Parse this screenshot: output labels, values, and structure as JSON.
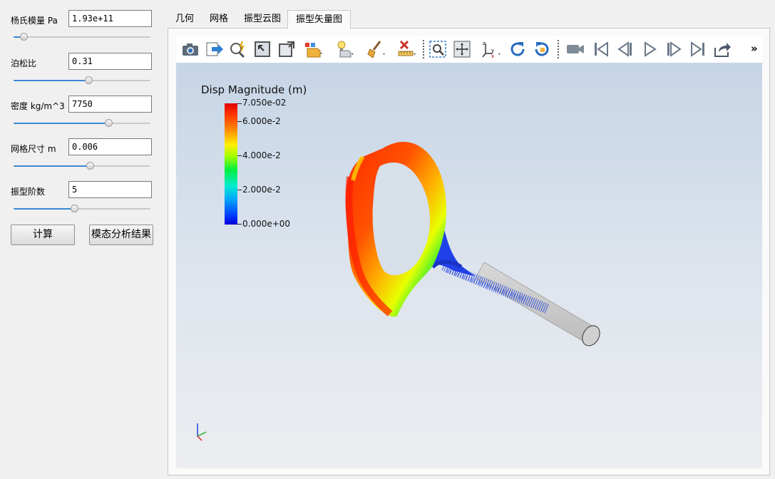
{
  "params": [
    {
      "label": "杨氏模量 Pa",
      "value": "1.93e+11",
      "slider": 0.08
    },
    {
      "label": "泊松比",
      "value": "0.31",
      "slider": 0.55
    },
    {
      "label": "密度 kg/m^3",
      "value": "7750",
      "slider": 0.7
    },
    {
      "label": "网格尺寸 m",
      "value": "0.006",
      "slider": 0.56
    },
    {
      "label": "振型阶数",
      "value": "5",
      "slider": 0.45
    }
  ],
  "buttons": {
    "compute": "计算",
    "results": "模态分析结果"
  },
  "tabs": [
    {
      "label": "几何",
      "active": false
    },
    {
      "label": "网格",
      "active": false
    },
    {
      "label": "振型云图",
      "active": false
    },
    {
      "label": "振型矢量图",
      "active": true
    }
  ],
  "toolbar": {
    "icons": [
      "camera-icon",
      "export-icon",
      "pick-icon",
      "reset-view-icon",
      "maximize-icon",
      "color-map-icon",
      "lighting-icon",
      "clean-icon",
      "ruler-icon",
      "zoom-box-icon",
      "fit-view-icon",
      "axes-orient-icon",
      "rotate-cw-icon",
      "rotate-ccw-icon",
      "record-icon",
      "first-frame-icon",
      "prev-frame-icon",
      "play-icon",
      "next-frame-icon",
      "last-frame-icon",
      "share-icon"
    ],
    "overflow": "»"
  },
  "legend": {
    "title": "Disp Magnitude (m)",
    "labels": [
      "7.050e-02",
      "6.000e-2",
      "4.000e-2",
      "2.000e-2",
      "0.000e+00"
    ],
    "colors": {
      "max": "#e10000",
      "mid": "#00ee40",
      "min": "#0000d8"
    }
  },
  "axes": {
    "x": "x",
    "y": "y",
    "z": "z"
  }
}
